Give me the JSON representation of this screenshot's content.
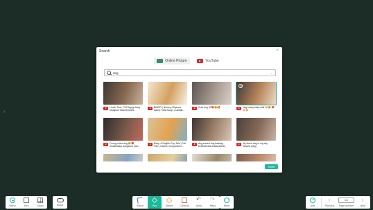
{
  "dialog": {
    "title": "Search",
    "close_symbol": "×",
    "tabs": [
      {
        "label": "Online Picture",
        "icon": "picture-icon",
        "active": true
      },
      {
        "label": "YouTube",
        "icon": "youtube-icon",
        "active": false
      }
    ],
    "search": {
      "value": "dog",
      "placeholder": "",
      "clear_symbol": "×"
    },
    "results": [
      {
        "title": "Lunch Time, 7🐶Happy #dog #dogfood #shorts #pets",
        "colors": [
          "#3b3634",
          "#8a6a52",
          "#c7b39a"
        ],
        "play_overlay": false
      },
      {
        "title": "BINGO | Nursery Rhymes &amp; Kids Songs | Lalitalk (Dog Song)",
        "colors": [
          "#f3e6cf",
          "#d3a160",
          "#f7f1e6"
        ],
        "play_overlay": false
      },
      {
        "title": "Cute dog 🐶❤️😍🥰",
        "colors": [
          "#5d5550",
          "#a89c92",
          "#d9d3cb"
        ],
        "play_overlay": false
      },
      {
        "title": "Hug husky baby milk 🐶😍 ❤️🌸🌼",
        "colors": [
          "#3e3a38",
          "#b8855a",
          "#e9dcc8"
        ],
        "play_overlay": true
      },
      {
        "title": "Funny police dog 😂❤️ #makeitstop #dogsoon #do...",
        "colors": [
          "#2c2b2d",
          "#7a5a4a",
          "#c46a5a"
        ],
        "play_overlay": false
      },
      {
        "title": "Body: A English Pop Tale | Full Film | Canine Companions...",
        "colors": [
          "#d9c39a",
          "#e4a24f",
          "#7fb0c9"
        ],
        "play_overlay": false
      },
      {
        "title": "dog scared dog barking - bestfulbirths #stinkysbirds",
        "colors": [
          "#3c3431",
          "#a0826b",
          "#d8c8b8"
        ],
        "play_overlay": false
      },
      {
        "title": "My friend dog in my day #shorts #dog",
        "colors": [
          "#4a403c",
          "#886a58",
          "#c8b4a4"
        ],
        "play_overlay": false
      },
      {
        "title": "",
        "colors": [
          "#c9b78f",
          "#88a4c2",
          "#e7dcc7"
        ],
        "play_overlay": false
      },
      {
        "title": "",
        "colors": [
          "#cda76a",
          "#e8cfa0",
          "#6a8fb7"
        ],
        "play_overlay": false
      },
      {
        "title": "",
        "colors": [
          "#e2dfd8",
          "#9b8a6a",
          "#cfc8be"
        ],
        "play_overlay": false
      },
      {
        "title": "",
        "colors": [
          "#7a5a4a",
          "#c09070",
          "#e0d0c0"
        ],
        "play_overlay": false
      }
    ],
    "insert_label": "Insert"
  },
  "toolbar": {
    "left": [
      {
        "label": "Menu",
        "icon": "menu-icon"
      },
      {
        "label": "Exit",
        "icon": "exit-icon"
      },
      {
        "label": "Show",
        "icon": "show-icon"
      }
    ],
    "cloud": {
      "label": "Cloud",
      "icon": "cloud-icon"
    },
    "center": [
      {
        "label": "Select",
        "icon": "select-icon",
        "active": false
      },
      {
        "label": "Pen",
        "icon": "pen-icon",
        "active": true
      },
      {
        "label": "Eraser",
        "icon": "eraser-icon",
        "active": false
      },
      {
        "label": "Clear All",
        "icon": "clear-all-icon",
        "active": false
      },
      {
        "label": "Undo",
        "icon": "undo-icon",
        "active": false
      },
      {
        "label": "Redo",
        "icon": "redo-icon",
        "active": false
      }
    ],
    "more": {
      "label": "More",
      "icon": "more-icon"
    },
    "right": {
      "add_label": "Add",
      "previous_label": "Previous",
      "page_value": "1/1",
      "page_number_label": "Page number",
      "next_label": "Next"
    }
  },
  "colors": {
    "background": "#1b2d26",
    "accent": "#1db99b",
    "youtube_red": "#e02424"
  }
}
